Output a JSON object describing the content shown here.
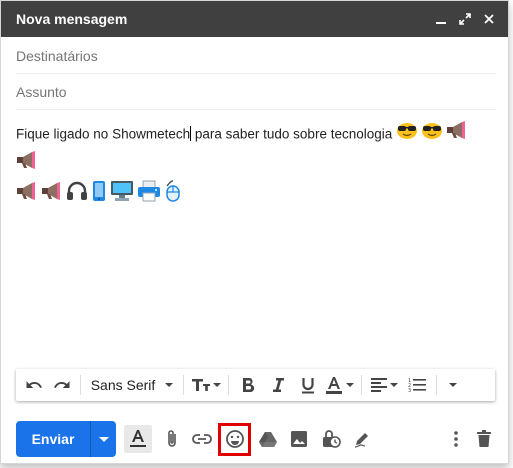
{
  "compose": {
    "title": "Nova mensagem",
    "to_placeholder": "Destinatários",
    "subject_placeholder": "Assunto",
    "body_text_before_caret": "Fique ligado no Showmetech",
    "body_text_after_caret": " para saber tudo sobre tecnologia",
    "emojis_line1": [
      "sunglasses-face",
      "sunglasses-face",
      "megaphone",
      "megaphone"
    ],
    "emojis_line2": [
      "megaphone",
      "megaphone",
      "headphones",
      "mobile-phone",
      "desktop-computer",
      "printer",
      "computer-mouse"
    ]
  },
  "toolbar": {
    "font_name": "Sans Serif"
  },
  "actions": {
    "send_label": "Enviar",
    "highlighted_button": "insert-emoji-button",
    "highlight_color": "#e00000"
  },
  "colors": {
    "titlebar": "#404040",
    "send_button": "#1a73e8"
  }
}
